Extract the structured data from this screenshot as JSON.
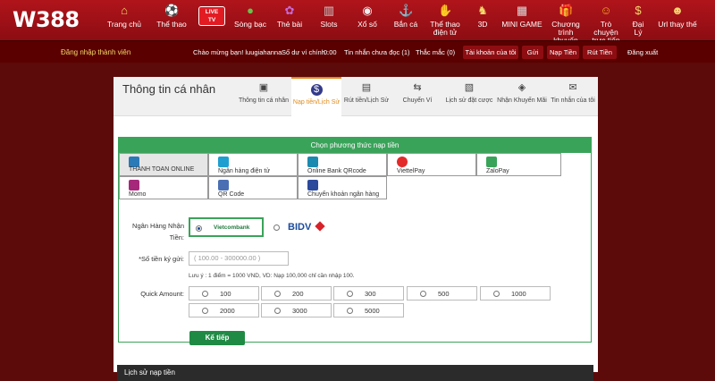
{
  "brand": {
    "logo": "W388"
  },
  "nav": {
    "items": [
      {
        "label": "Trang chủ",
        "icon": "home-icon"
      },
      {
        "label": "Thể thao",
        "icon": "soccer-ball-icon"
      },
      {
        "label": "LIVE TV",
        "icon": "live-tv-icon"
      },
      {
        "label": "Sòng bạc",
        "icon": "casino-chip-icon"
      },
      {
        "label": "Thẻ bài",
        "icon": "playing-card-icon"
      },
      {
        "label": "Slots",
        "icon": "slot-machine-icon"
      },
      {
        "label": "Xổ số",
        "icon": "lottery-ball-icon"
      },
      {
        "label": "Bắn cá",
        "icon": "anchor-icon"
      },
      {
        "label": "Thể thao điện tử",
        "icon": "esports-icon"
      },
      {
        "label": "3D",
        "icon": "horse-icon"
      },
      {
        "label": "MINI GAME",
        "icon": "mini-game-icon"
      },
      {
        "label": "Chương trình khuyến mãi",
        "icon": "gift-icon"
      },
      {
        "label": "Trò chuyện trực tiếp",
        "icon": "chat-agent-icon"
      },
      {
        "label": "Đại Lý",
        "icon": "money-bag-icon"
      },
      {
        "label": "Url thay thế",
        "icon": "smiley-icon"
      }
    ]
  },
  "infobar": {
    "login": "Đăng nhập thành viên",
    "greeting": "Chào mừng bạn! luugiahanna",
    "balance_label": "Số dư ví chính :",
    "balance_value": "0.00",
    "messages": "Tin nhắn chưa đọc (1)",
    "questions": "Thắc mắc (0)",
    "buttons": [
      "Tài khoản của tôi",
      "Gửi",
      "Nạp Tiền",
      "Rút Tiền"
    ],
    "logout": "Đăng xuất"
  },
  "panel": {
    "title": "Thông tin cá nhân",
    "tabs": [
      {
        "label": "Thông tin cá nhân",
        "icon": "id-card-icon"
      },
      {
        "label": "Nạp tiền/Lịch Sử",
        "icon": "dollar-coin-icon"
      },
      {
        "label": "Rút tiền/Lịch Sử",
        "icon": "wallet-icon"
      },
      {
        "label": "Chuyển Ví",
        "icon": "transfer-arrows-icon"
      },
      {
        "label": "Lịch sử đặt cược",
        "icon": "bet-history-icon"
      },
      {
        "label": "Nhận Khuyến Mãi",
        "icon": "tag-icon"
      },
      {
        "label": "Tin nhắn của tôi",
        "icon": "envelope-icon"
      }
    ]
  },
  "deposit": {
    "header": "Chọn phương thức nạp tiền",
    "methods": [
      {
        "label": "THANH TOAN ONLINE",
        "icon": "online-payment-icon"
      },
      {
        "label": "Ngân hàng điện tử",
        "icon": "e-banking-icon"
      },
      {
        "label": "Online Bank QRcode",
        "icon": "qr-bank-icon"
      },
      {
        "label": "ViettelPay",
        "icon": "viettelpay-icon"
      },
      {
        "label": "ZaloPay",
        "icon": "zalopay-icon"
      },
      {
        "label": "Momo",
        "icon": "momo-icon"
      },
      {
        "label": "QR Code",
        "icon": "qr-code-icon"
      },
      {
        "label": "Chuyển khoản ngân hàng",
        "icon": "bank-transfer-icon"
      }
    ],
    "bank_label": "Ngân Hàng Nhận Tiền:",
    "banks": [
      "Vietcombank",
      "BIDV"
    ],
    "amount_label": "*Số tiền ký gửi:",
    "amount_placeholder": "( 100.00 - 300000.00 )",
    "note": "Lưu ý : 1 điểm = 1000 VND, VD: Nạp 100,000 chỉ cần nhập 100.",
    "quick_label": "Quick Amount:",
    "quick_amounts": [
      "100",
      "200",
      "300",
      "500",
      "1000",
      "2000",
      "3000",
      "5000"
    ],
    "next_button": "Kế tiếp"
  },
  "history": {
    "title": "Lịch sử nạp tiền"
  },
  "colors": {
    "brand_red": "#b0141b",
    "accent_green": "#3aa35a",
    "active_tab": "#e08a1b"
  }
}
